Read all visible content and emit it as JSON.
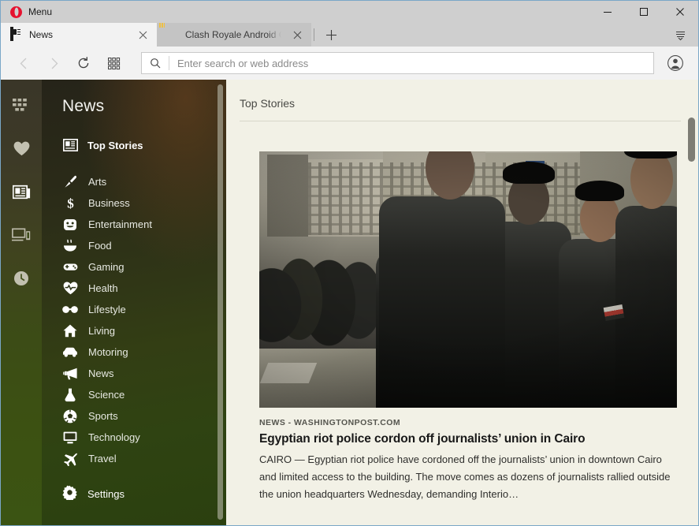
{
  "window": {
    "menu_label": "Menu",
    "controls": {
      "minimize": "minimize-icon",
      "maximize": "maximize-icon",
      "close": "close-icon"
    }
  },
  "tabs": {
    "items": [
      {
        "title": "News",
        "favicon": "news-favicon",
        "active": true
      },
      {
        "title": "Clash Royale Android Gam",
        "favicon": "clash-royale-favicon",
        "active": false
      }
    ],
    "new_tab_label": "+",
    "tab_menu_icon": "tab-menu-icon"
  },
  "toolbar": {
    "back_icon": "back-arrow-icon",
    "forward_icon": "forward-arrow-icon",
    "reload_icon": "reload-icon",
    "speeddial_icon": "speed-dial-icon",
    "search_icon": "search-icon",
    "profile_icon": "profile-avatar-icon"
  },
  "address_bar": {
    "value": "",
    "placeholder": "Enter search or web address"
  },
  "rail": {
    "items": [
      {
        "name": "speed-dial",
        "icon": "grid-icon"
      },
      {
        "name": "bookmarks",
        "icon": "heart-icon"
      },
      {
        "name": "news",
        "icon": "news-icon",
        "active": true
      },
      {
        "name": "my-flow",
        "icon": "devices-icon"
      },
      {
        "name": "history",
        "icon": "clock-icon"
      }
    ]
  },
  "sidebar": {
    "title": "News",
    "top_stories": {
      "label": "Top Stories",
      "icon": "news-feed-icon"
    },
    "categories": [
      {
        "label": "Arts",
        "icon": "brush-icon"
      },
      {
        "label": "Business",
        "icon": "dollar-icon"
      },
      {
        "label": "Entertainment",
        "icon": "theater-mask-icon"
      },
      {
        "label": "Food",
        "icon": "bowl-icon"
      },
      {
        "label": "Gaming",
        "icon": "gamepad-icon"
      },
      {
        "label": "Health",
        "icon": "heart-pulse-icon"
      },
      {
        "label": "Lifestyle",
        "icon": "sunglasses-icon"
      },
      {
        "label": "Living",
        "icon": "home-icon"
      },
      {
        "label": "Motoring",
        "icon": "car-icon"
      },
      {
        "label": "News",
        "icon": "megaphone-icon"
      },
      {
        "label": "Science",
        "icon": "flask-icon"
      },
      {
        "label": "Sports",
        "icon": "soccer-ball-icon"
      },
      {
        "label": "Technology",
        "icon": "monitor-icon"
      },
      {
        "label": "Travel",
        "icon": "airplane-icon"
      }
    ],
    "settings": {
      "label": "Settings",
      "icon": "gear-icon"
    }
  },
  "main": {
    "heading": "Top Stories",
    "article": {
      "source": "NEWS - WASHINGTONPOST.COM",
      "title": "Egyptian riot police cordon off journalists’ union in Cairo",
      "body": "CAIRO — Egyptian riot police have cordoned off the journalists’ union in downtown Cairo and limited access to the building. The move comes as dozens of journalists rallied outside the union headquarters Wednesday, demanding Interio…",
      "image_alt": "riot-police-photo"
    }
  },
  "colors": {
    "opera_red": "#e6122f",
    "titlebar": "#cfcfcf",
    "toolbar": "#f2f2f2",
    "content_bg": "#f2f1e6",
    "sidebar_green": "#3b5413"
  }
}
